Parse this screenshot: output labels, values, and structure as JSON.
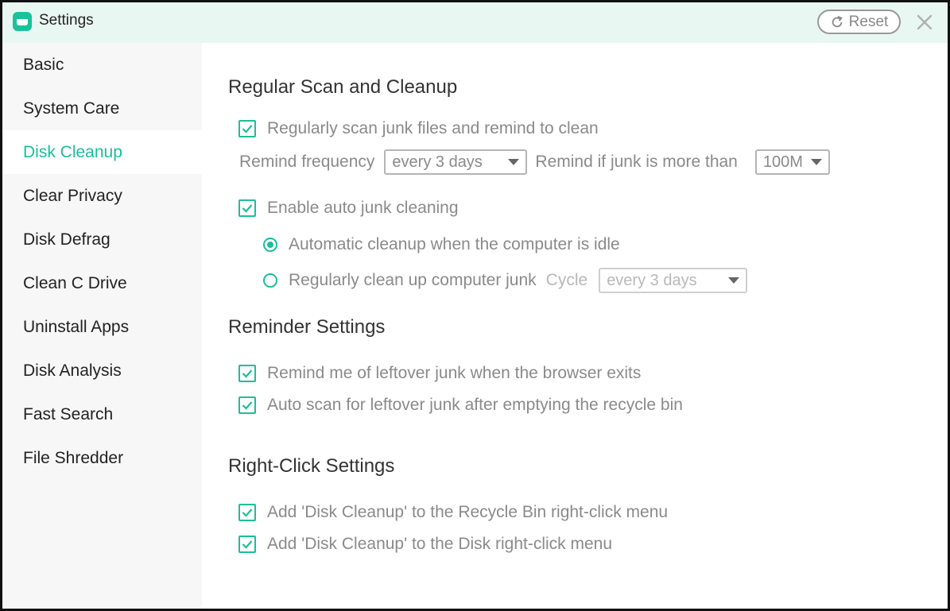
{
  "window": {
    "title": "Settings",
    "reset_label": "Reset"
  },
  "sidebar": {
    "items": [
      {
        "label": "Basic"
      },
      {
        "label": "System Care"
      },
      {
        "label": "Disk Cleanup",
        "active": true
      },
      {
        "label": "Clear Privacy"
      },
      {
        "label": "Disk Defrag"
      },
      {
        "label": "Clean C Drive"
      },
      {
        "label": "Uninstall Apps"
      },
      {
        "label": "Disk Analysis"
      },
      {
        "label": "Fast Search"
      },
      {
        "label": "File Shredder"
      }
    ]
  },
  "regular_scan": {
    "title": "Regular Scan and Cleanup",
    "scan_option": {
      "label": "Regularly scan junk files and remind to clean",
      "checked": true
    },
    "remind_frequency_label": "Remind frequency",
    "remind_frequency_value": "every 3 days",
    "junk_threshold_label": "Remind if junk is more than",
    "junk_threshold_value": "100M",
    "auto_clean_option": {
      "label": "Enable auto junk cleaning",
      "checked": true
    },
    "idle_option": {
      "label": "Automatic cleanup when the computer is idle",
      "selected": true
    },
    "cycle_option": {
      "label": "Regularly clean up computer junk",
      "selected": false
    },
    "cycle_label": "Cycle",
    "cycle_value": "every 3 days"
  },
  "reminder": {
    "title": "Reminder Settings",
    "browser_exit": {
      "label": "Remind me of leftover junk when the browser exits",
      "checked": true
    },
    "recycle_bin": {
      "label": "Auto scan for leftover junk after emptying the recycle bin",
      "checked": true
    }
  },
  "right_click": {
    "title": "Right-Click Settings",
    "recycle_menu": {
      "label": "Add 'Disk Cleanup' to the Recycle Bin right-click menu",
      "checked": true
    },
    "disk_menu": {
      "label": "Add 'Disk Cleanup' to the Disk right-click menu",
      "checked": true
    }
  },
  "colors": {
    "accent": "#1bbf9a",
    "titlebar_bg": "#e9f7f3",
    "sidebar_bg": "#f7f7f7"
  }
}
